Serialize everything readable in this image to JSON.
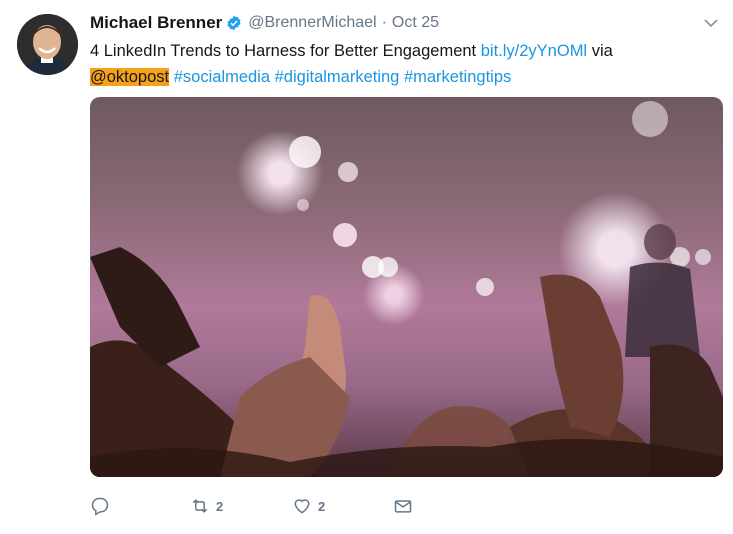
{
  "tweet": {
    "author_name": "Michael Brenner",
    "handle": "@BrennerMichael",
    "separator": "·",
    "date": "Oct 25",
    "text_prefix": "4 LinkedIn Trends to Harness for Better Engagement ",
    "link": "bit.ly/2yYnOMl",
    "text_via": " via",
    "mention": "@oktopost",
    "hashtags": [
      "#socialmedia",
      "#digitalmarketing",
      "#marketingtips"
    ]
  },
  "actions": {
    "reply_count": "",
    "retweet_count": "2",
    "like_count": "2"
  },
  "colors": {
    "link": "#1b95e0",
    "mention_highlight": "#f6a11a",
    "verified": "#1da1f2",
    "muted": "#657786"
  },
  "icons": [
    "verified-icon",
    "chevron-down-icon",
    "reply-icon",
    "retweet-icon",
    "like-icon",
    "direct-message-icon"
  ]
}
